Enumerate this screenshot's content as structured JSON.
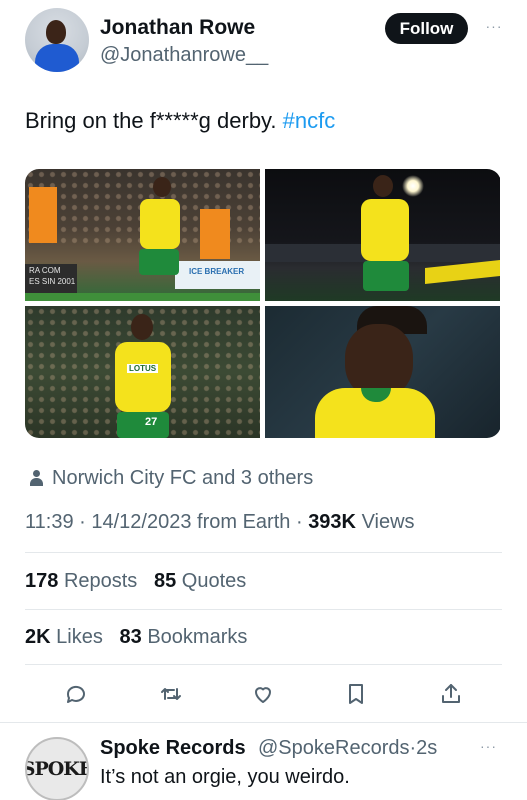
{
  "author": {
    "display_name": "Jonathan Rowe",
    "handle": "@Jonathanrowe__"
  },
  "follow_label": "Follow",
  "more_label": "···",
  "tweet": {
    "text_main": "Bring on the f*****g derby. ",
    "hashtag": "#ncfc"
  },
  "media": {
    "photo_count": 4,
    "photo_1_board_text": "ICE BREAKER",
    "photo_1_side_text": "RA COM",
    "photo_1_side_text2": "ES SIN 2001",
    "photo_3_sponsor": "LOTUS",
    "photo_3_number": "27"
  },
  "tagged": {
    "text": "Norwich City FC and 3 others"
  },
  "meta": {
    "time": "11:39",
    "date": "14/12/2023",
    "source": "from Earth",
    "views_count": "393K",
    "views_label": "Views"
  },
  "stats": {
    "reposts_count": "178",
    "reposts_label": "Reposts",
    "quotes_count": "85",
    "quotes_label": "Quotes",
    "likes_count": "2K",
    "likes_label": "Likes",
    "bookmarks_count": "83",
    "bookmarks_label": "Bookmarks"
  },
  "actions": {
    "icons": [
      "reply-icon",
      "repost-icon",
      "like-icon",
      "bookmark-icon",
      "share-icon"
    ]
  },
  "reply": {
    "avatar_text": "SPOKE",
    "display_name": "Spoke Records",
    "handle": "@SpokeRecords",
    "time": "2s",
    "text": "It’s not an orgie, you weirdo."
  },
  "colors": {
    "accent": "#1d9bf0",
    "text_primary": "#0f1419",
    "text_secondary": "#536471",
    "divider": "#e4e8eb",
    "follow_bg": "#0f1419"
  }
}
